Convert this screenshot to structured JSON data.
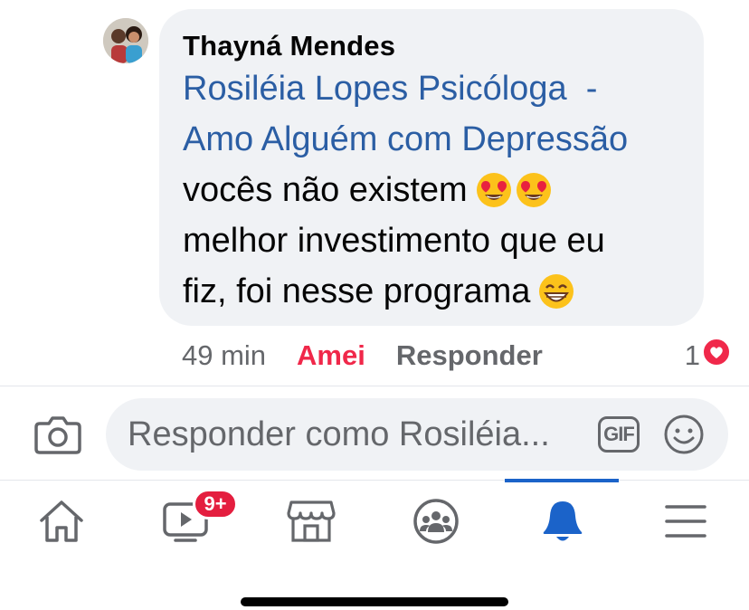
{
  "comment": {
    "author": "Thayná Mendes",
    "mention_line1": "Rosiléia Lopes Psicóloga  -",
    "mention_line2": "Amo Alguém com Depressão",
    "text_line1": "vocês não existem",
    "text_line2": "melhor investimento que eu",
    "text_line3": "fiz, foi nesse programa",
    "emojis": [
      "heart-eyes-emoji",
      "heart-eyes-emoji",
      "grinning-emoji"
    ]
  },
  "actions": {
    "time": "49 min",
    "love_label": "Amei",
    "reply_label": "Responder",
    "reaction_count": "1",
    "reaction_icon": "heart-icon"
  },
  "composer": {
    "placeholder": "Responder como Rosiléia...",
    "gif_label": "GIF",
    "camera_icon": "camera-icon",
    "sticker_icon": "smiley-icon"
  },
  "nav": {
    "items": [
      "home-icon",
      "video-icon",
      "marketplace-icon",
      "groups-icon",
      "notifications-icon",
      "menu-icon"
    ],
    "video_badge": "9+",
    "active": "notifications-icon"
  },
  "colors": {
    "link": "#2b5ea4",
    "love": "#f0284a",
    "active": "#1b63c9",
    "badge": "#e41e3f",
    "bubble": "#f0f2f5",
    "muted": "#65676b"
  }
}
